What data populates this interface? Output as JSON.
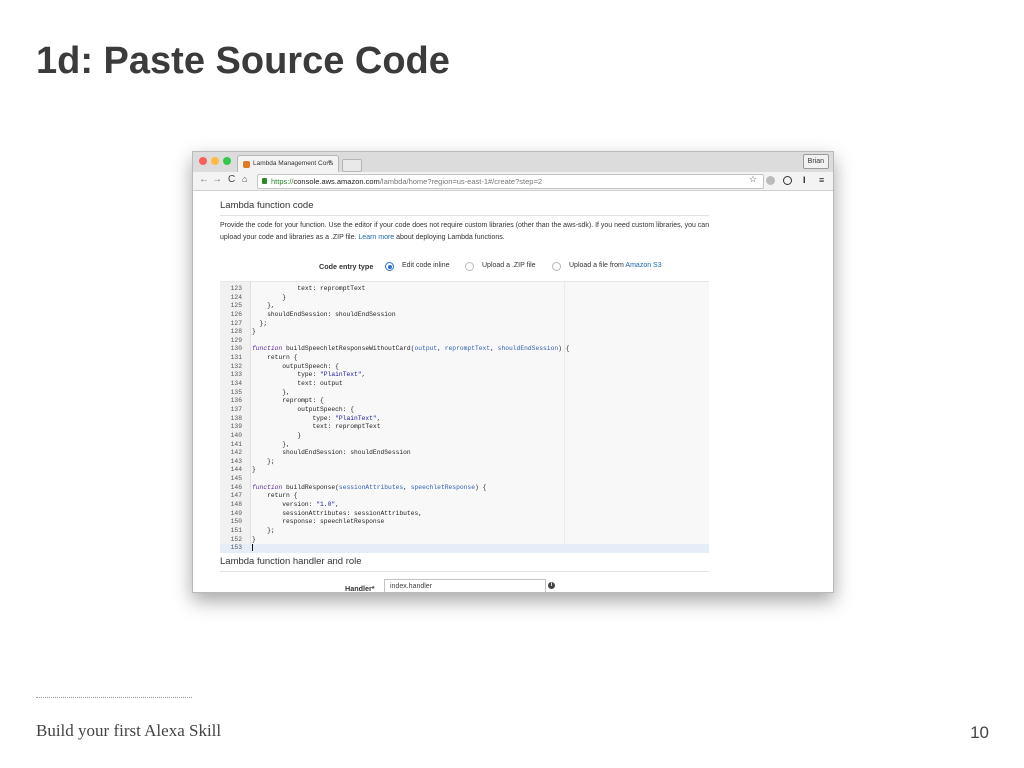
{
  "slide": {
    "title": "1d: Paste Source Code",
    "footer": "Build your first Alexa Skill",
    "page_number": "10"
  },
  "browser": {
    "tab_title": "Lambda Management Cons",
    "tab_close": "×",
    "profile_name": "Brian",
    "url_scheme": "https://",
    "url_host": "console.aws.amazon.com",
    "url_path": "/lambda/home?region=us-east-1#/create?step=2",
    "icons": [
      "back-icon",
      "forward-icon",
      "reload-icon",
      "home-icon",
      "lock-icon",
      "star-icon",
      "extension-icon",
      "menu-icon"
    ],
    "traffic_lights": [
      "#fc605c",
      "#fdbc40",
      "#34c84a"
    ]
  },
  "page": {
    "section1_title": "Lambda function code",
    "description_part1": "Provide the code for your function. Use the editor if your code does not require custom libraries (other than the aws-sdk). If you need custom libraries, you can upload your code and libraries as a .ZIP file. ",
    "description_link": "Learn more",
    "description_part2": " about deploying Lambda functions.",
    "code_entry_type_label": "Code entry type",
    "options": {
      "inline": "Edit code inline",
      "zip": "Upload a .ZIP file",
      "s3": "Upload a file from ",
      "s3_link": "Amazon S3"
    },
    "selected_option": "Edit code inline",
    "section2_title": "Lambda function handler and role",
    "handler_label": "Handler*",
    "handler_value": "index.handler"
  },
  "code": [
    {
      "n": "123",
      "t": "            text: repromptText"
    },
    {
      "n": "124",
      "t": "        }"
    },
    {
      "n": "125",
      "t": "    },"
    },
    {
      "n": "126",
      "t": "    shouldEndSession: shouldEndSession"
    },
    {
      "n": "127",
      "t": "  };"
    },
    {
      "n": "128",
      "t": "}"
    },
    {
      "n": "129",
      "t": ""
    },
    {
      "n": "130",
      "kw": "function",
      "t": " buildSpeechletResponseWithoutCard(",
      "params": [
        "output",
        "repromptText",
        "shouldEndSession"
      ],
      "end": ") {"
    },
    {
      "n": "131",
      "t": "    return {"
    },
    {
      "n": "132",
      "t": "        outputSpeech: {"
    },
    {
      "n": "133",
      "t": "            type: ",
      "s": "\"PlainText\"",
      "end": ","
    },
    {
      "n": "134",
      "t": "            text: output"
    },
    {
      "n": "135",
      "t": "        },"
    },
    {
      "n": "136",
      "t": "        reprompt: {"
    },
    {
      "n": "137",
      "t": "            outputSpeech: {"
    },
    {
      "n": "138",
      "t": "                type: ",
      "s": "\"PlainText\"",
      "end": ","
    },
    {
      "n": "139",
      "t": "                text: repromptText"
    },
    {
      "n": "140",
      "t": "            }"
    },
    {
      "n": "141",
      "t": "        },"
    },
    {
      "n": "142",
      "t": "        shouldEndSession: shouldEndSession"
    },
    {
      "n": "143",
      "t": "    };"
    },
    {
      "n": "144",
      "t": "}"
    },
    {
      "n": "145",
      "t": ""
    },
    {
      "n": "146",
      "kw": "function",
      "t": " buildResponse(",
      "params": [
        "sessionAttributes",
        "speechletResponse"
      ],
      "end": ") {"
    },
    {
      "n": "147",
      "t": "    return {"
    },
    {
      "n": "148",
      "t": "        version: ",
      "s": "\"1.0\"",
      "end": ","
    },
    {
      "n": "149",
      "t": "        sessionAttributes: sessionAttributes,"
    },
    {
      "n": "150",
      "t": "        response: speechletResponse"
    },
    {
      "n": "151",
      "t": "    };"
    },
    {
      "n": "152",
      "t": "}"
    },
    {
      "n": "153",
      "t": "",
      "active": true
    }
  ]
}
